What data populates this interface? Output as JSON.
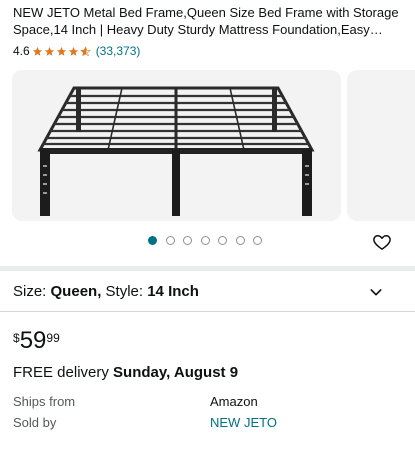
{
  "product": {
    "title": "NEW JETO Metal Bed Frame,Queen Size Bed Frame with Storage Space,14 Inch | Heavy Duty Sturdy Mattress Foundation,Easy…",
    "rating_value": "4.6",
    "rating_stars": 4.6,
    "review_count": "(33,373)"
  },
  "gallery": {
    "image_icon": "bed-frame-image",
    "dot_count": 7,
    "active_index": 0
  },
  "options": {
    "size_label": "Size:",
    "size_value": "Queen,",
    "style_label": "Style:",
    "style_value": "14 Inch"
  },
  "price": {
    "symbol": "$",
    "whole": "59",
    "fraction": "99"
  },
  "delivery": {
    "prefix": "FREE delivery",
    "date": "Sunday, August 9"
  },
  "seller": {
    "ships_from_label": "Ships from",
    "ships_from_value": "Amazon",
    "sold_by_label": "Sold by",
    "sold_by_value": "NEW JETO"
  },
  "colors": {
    "link": "#007185",
    "star": "#de7921",
    "text": "#0f1111"
  }
}
